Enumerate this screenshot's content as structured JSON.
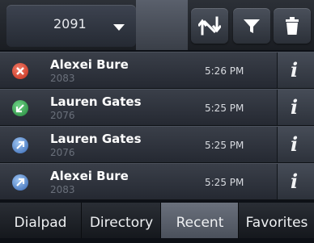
{
  "header": {
    "line_number": "2091",
    "buttons": [
      {
        "name": "sort",
        "icon": "sort-arrows-icon"
      },
      {
        "name": "filter",
        "icon": "filter-funnel-icon"
      },
      {
        "name": "delete",
        "icon": "trash-icon"
      }
    ]
  },
  "calls": [
    {
      "name": "Alexei Bure",
      "number": "2083",
      "time": "5:26 PM",
      "status": "missed",
      "status_color": "#d8452e",
      "icon": "missed-call-icon"
    },
    {
      "name": "Lauren Gates",
      "number": "2076",
      "time": "5:25 PM",
      "status": "received",
      "status_color": "#3aa852",
      "icon": "incoming-call-icon"
    },
    {
      "name": "Lauren Gates",
      "number": "2076",
      "time": "5:25 PM",
      "status": "placed",
      "status_color": "#3f79c9",
      "icon": "outgoing-call-icon"
    },
    {
      "name": "Alexei Bure",
      "number": "2083",
      "time": "5:25 PM",
      "status": "placed",
      "status_color": "#3f79c9",
      "icon": "outgoing-call-icon"
    }
  ],
  "info_label": "i",
  "tabs": [
    {
      "label": "Dialpad",
      "active": false
    },
    {
      "label": "Directory",
      "active": false
    },
    {
      "label": "Recent",
      "active": true
    },
    {
      "label": "Favorites",
      "active": false
    }
  ]
}
